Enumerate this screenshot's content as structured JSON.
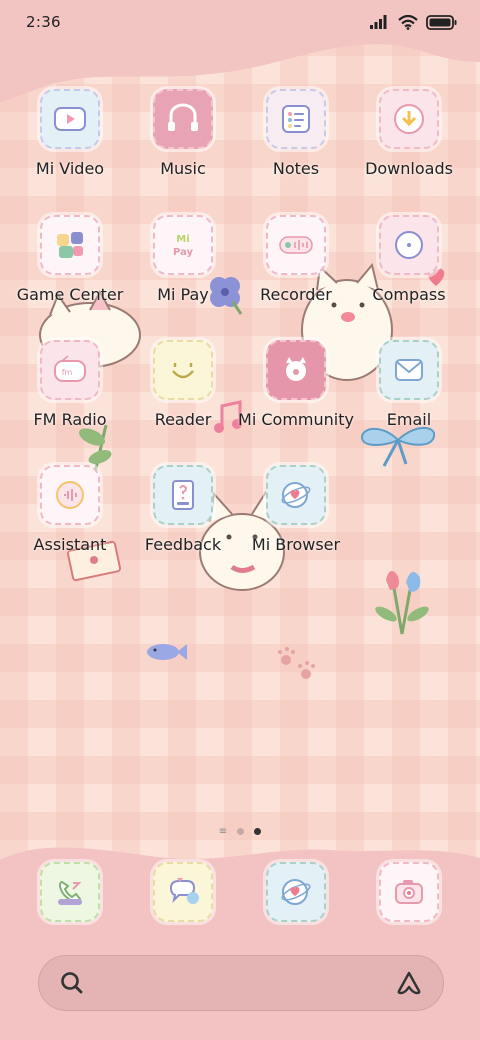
{
  "status_bar": {
    "time": "2:36"
  },
  "apps": [
    {
      "label": "Mi Video",
      "icon": "video-icon"
    },
    {
      "label": "Music",
      "icon": "music-icon"
    },
    {
      "label": "Notes",
      "icon": "notes-icon"
    },
    {
      "label": "Downloads",
      "icon": "download-icon"
    },
    {
      "label": "Game Center",
      "icon": "game-icon"
    },
    {
      "label": "Mi Pay",
      "icon": "pay-icon"
    },
    {
      "label": "Recorder",
      "icon": "recorder-icon"
    },
    {
      "label": "Compass",
      "icon": "compass-icon"
    },
    {
      "label": "FM Radio",
      "icon": "radio-icon"
    },
    {
      "label": "Reader",
      "icon": "reader-icon"
    },
    {
      "label": "Mi Community",
      "icon": "community-icon"
    },
    {
      "label": "Email",
      "icon": "email-icon"
    },
    {
      "label": "Assistant",
      "icon": "assistant-icon"
    },
    {
      "label": "Feedback",
      "icon": "feedback-icon"
    },
    {
      "label": "Mi Browser",
      "icon": "browser-icon"
    }
  ],
  "icon_texts": {
    "fm": "fm",
    "mi_pay": "Mi",
    "pay": "Pay"
  },
  "dock": [
    {
      "icon": "phone-icon"
    },
    {
      "icon": "messages-icon"
    },
    {
      "icon": "browser-icon"
    },
    {
      "icon": "camera-icon"
    }
  ],
  "pages": {
    "count": 2,
    "current": 2
  },
  "colors": {
    "background": "#fbe3d9",
    "wave": "#f2c4c2",
    "dock": "#f3c3c3",
    "tile_blue": "#e3f0f6",
    "tile_pink": "#f4c5d0",
    "tile_cream": "#fbf6d8"
  }
}
